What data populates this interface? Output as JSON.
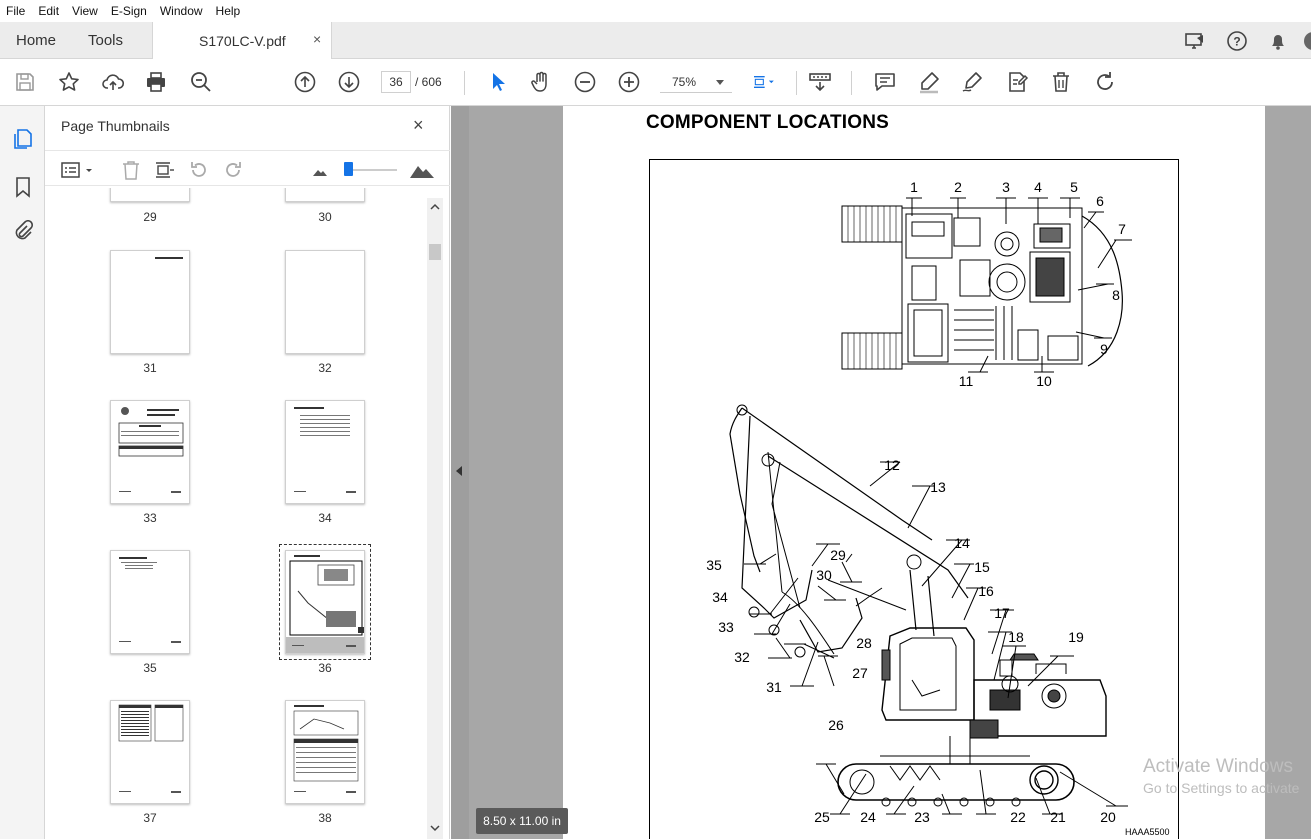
{
  "menu": [
    "File",
    "Edit",
    "View",
    "E-Sign",
    "Window",
    "Help"
  ],
  "tabs": {
    "home": "Home",
    "tools": "Tools",
    "document": "S170LC-V.pdf",
    "close": "×"
  },
  "toolbar": {
    "current_page": "36",
    "page_total": "/ 606",
    "zoom": "75%"
  },
  "panel": {
    "title": "Page Thumbnails",
    "close": "×",
    "thumbnails": [
      "29",
      "30",
      "31",
      "32",
      "33",
      "34",
      "35",
      "36",
      "37",
      "38"
    ],
    "selected": "36"
  },
  "page": {
    "title": "COMPONENT LOCATIONS",
    "figure_id": "HAAA5500",
    "callouts": [
      "1",
      "2",
      "3",
      "4",
      "5",
      "6",
      "7",
      "8",
      "9",
      "10",
      "11",
      "12",
      "13",
      "14",
      "15",
      "16",
      "17",
      "18",
      "19",
      "20",
      "21",
      "22",
      "23",
      "24",
      "25",
      "26",
      "27",
      "28",
      "29",
      "30",
      "31",
      "32",
      "33",
      "34",
      "35"
    ]
  },
  "status": {
    "page_size": "8.50 x 11.00 in"
  },
  "watermark": {
    "line1": "Activate Windows",
    "line2": "Go to Settings to activate"
  },
  "colors": {
    "accent": "#1473e6",
    "page_bg": "#a7a7a7"
  }
}
